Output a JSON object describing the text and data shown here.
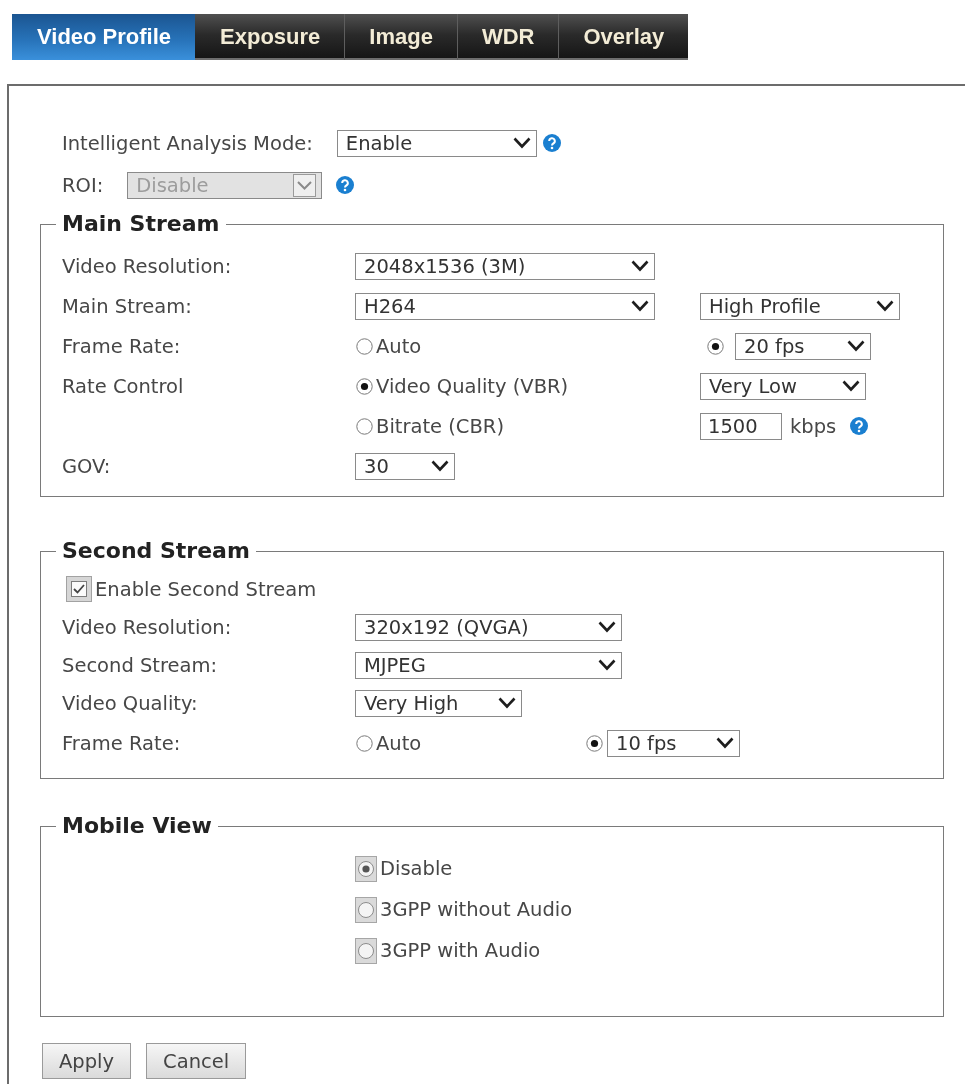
{
  "tabs": [
    {
      "label": "Video Profile",
      "selected": true
    },
    {
      "label": "Exposure",
      "selected": false
    },
    {
      "label": "Image",
      "selected": false
    },
    {
      "label": "WDR",
      "selected": false
    },
    {
      "label": "Overlay",
      "selected": false
    }
  ],
  "general": [
    {
      "label": "Intelligent Analysis Mode:",
      "value": "Enable",
      "disabled": false,
      "help": true
    },
    {
      "label": "ROI:",
      "value": "Disable",
      "disabled": true,
      "help": true
    }
  ],
  "main_stream": {
    "title": "Main Stream",
    "video_resolution": {
      "label": "Video Resolution:",
      "value": "2048x1536 (3M)"
    },
    "codec": {
      "label": "Main Stream:",
      "value": "H264",
      "profile": "High Profile"
    },
    "frame_rate": {
      "label": "Frame Rate:",
      "options": [
        {
          "label": "Auto",
          "selected": false
        },
        {
          "value": "20 fps",
          "selected": true
        }
      ]
    },
    "rate_control": {
      "label": "Rate Control",
      "options": [
        {
          "label": "Video Quality (VBR)",
          "selected": true
        },
        {
          "label": "Bitrate (CBR)",
          "selected": false
        }
      ],
      "quality": "Very Low",
      "bitrate": {
        "value": "1500",
        "unit": "kbps",
        "help": true
      }
    },
    "gov": {
      "label": "GOV:",
      "value": "30"
    }
  },
  "second_stream": {
    "title": "Second Stream",
    "enable": {
      "label": "Enable Second Stream",
      "checked": true
    },
    "video_resolution": {
      "label": "Video Resolution:",
      "value": "320x192 (QVGA)"
    },
    "codec": {
      "label": "Second Stream:",
      "value": "MJPEG"
    },
    "video_quality": {
      "label": "Video Quality:",
      "value": "Very High"
    },
    "frame_rate": {
      "label": "Frame Rate:",
      "options": [
        {
          "label": "Auto",
          "selected": false
        },
        {
          "value": "10 fps",
          "selected": true
        }
      ]
    }
  },
  "mobile_view": {
    "title": "Mobile View",
    "options": [
      {
        "label": "Disable",
        "selected": true,
        "disabled": true
      },
      {
        "label": "3GPP without Audio",
        "selected": false,
        "disabled": true
      },
      {
        "label": "3GPP with Audio",
        "selected": false,
        "disabled": true
      }
    ]
  },
  "buttons": [
    "Apply",
    "Cancel"
  ]
}
